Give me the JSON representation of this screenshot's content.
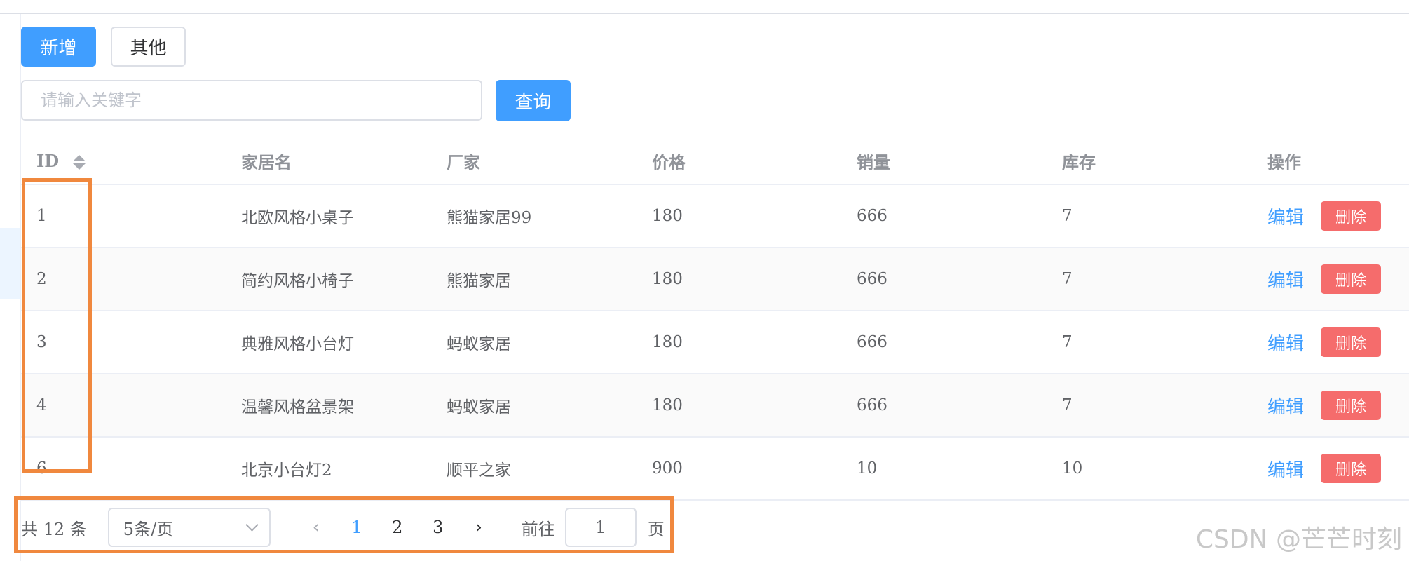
{
  "toolbar": {
    "add_label": "新增",
    "other_label": "其他",
    "query_label": "查询"
  },
  "search": {
    "placeholder": "请输入关键字",
    "value": ""
  },
  "table": {
    "headers": {
      "id": "ID",
      "name": "家居名",
      "maker": "厂家",
      "price": "价格",
      "sales": "销量",
      "stock": "库存",
      "op": "操作"
    },
    "rows": [
      {
        "id": "1",
        "name": "北欧风格小桌子",
        "maker": "熊猫家居99",
        "price": "180",
        "sales": "666",
        "stock": "7"
      },
      {
        "id": "2",
        "name": "简约风格小椅子",
        "maker": "熊猫家居",
        "price": "180",
        "sales": "666",
        "stock": "7"
      },
      {
        "id": "3",
        "name": "典雅风格小台灯",
        "maker": "蚂蚁家居",
        "price": "180",
        "sales": "666",
        "stock": "7"
      },
      {
        "id": "4",
        "name": "温馨风格盆景架",
        "maker": "蚂蚁家居",
        "price": "180",
        "sales": "666",
        "stock": "7"
      },
      {
        "id": "6",
        "name": "北京小台灯2",
        "maker": "顺平之家",
        "price": "900",
        "sales": "10",
        "stock": "10"
      }
    ],
    "edit_label": "编辑",
    "delete_label": "删除"
  },
  "pagination": {
    "total_text": "共 12 条",
    "page_size": "5条/页",
    "pages": [
      "1",
      "2",
      "3"
    ],
    "current_page": "1",
    "goto_prefix": "前往",
    "goto_value": "1",
    "goto_suffix": "页"
  },
  "watermark": "CSDN @芒芒时刻",
  "colors": {
    "primary": "#409eff",
    "danger": "#f56c6c",
    "highlight": "#f0883e"
  }
}
